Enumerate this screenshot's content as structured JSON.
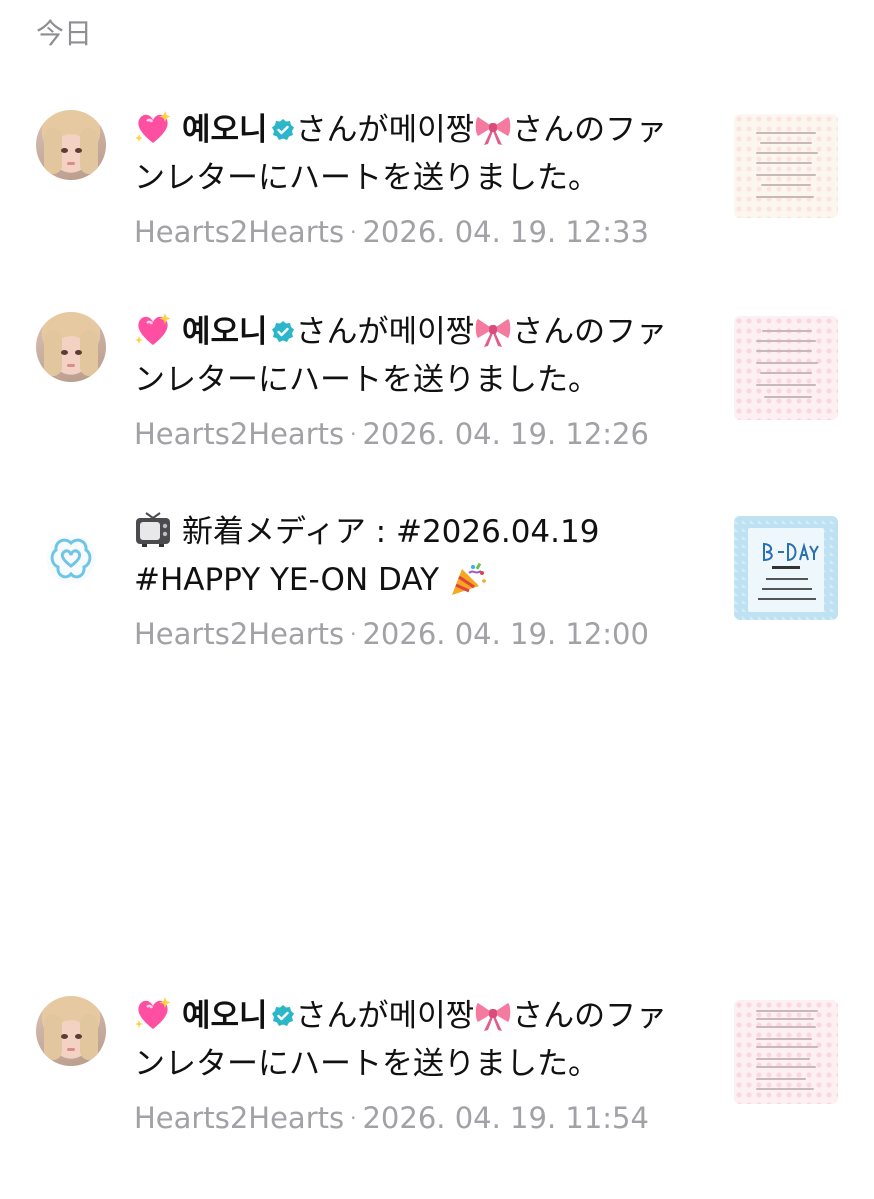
{
  "section": {
    "title": "今日"
  },
  "notifications": [
    {
      "type": "heart",
      "lead_emoji": "sparkling-heart-icon",
      "actor": "예오니",
      "part1": "さんが",
      "recipient": "메이짱",
      "mid_emoji": "ribbon-icon",
      "part2": "さんのファンレターにハートを送りました。",
      "source": "Hearts2Hearts",
      "separator": "·",
      "timestamp": "2026. 04. 19. 12:33",
      "thumbnail": "fan-letter-cream"
    },
    {
      "type": "heart",
      "lead_emoji": "sparkling-heart-icon",
      "actor": "예오니",
      "part1": "さんが",
      "recipient": "메이짱",
      "mid_emoji": "ribbon-icon",
      "part2": "さんのファンレターにハートを送りました。",
      "source": "Hearts2Hearts",
      "separator": "·",
      "timestamp": "2026. 04. 19. 12:26",
      "thumbnail": "fan-letter-pink"
    },
    {
      "type": "media",
      "lead_emoji": "television-icon",
      "text_line1": "新着メディア : #2026.04.19",
      "text_line2": "#HAPPY YE-ON DAY",
      "trail_emoji": "party-popper-icon",
      "source": "Hearts2Hearts",
      "separator": "·",
      "timestamp": "2026. 04. 19. 12:00",
      "thumbnail": "b-day-card"
    },
    {
      "type": "heart",
      "lead_emoji": "sparkling-heart-icon",
      "actor": "예오니",
      "part1": "さんが",
      "recipient": "메이짱",
      "mid_emoji": "ribbon-icon",
      "part2": "さんのファンレターにハートを送りました。",
      "source": "Hearts2Hearts",
      "separator": "·",
      "timestamp": "2026. 04. 19. 11:54",
      "thumbnail": "fan-letter-pink"
    }
  ],
  "colors": {
    "verified": "#2bb7c9",
    "meta_text": "#a1a1a6",
    "section_header": "#8e8e93",
    "brand_logo": "#6ec6e6"
  }
}
